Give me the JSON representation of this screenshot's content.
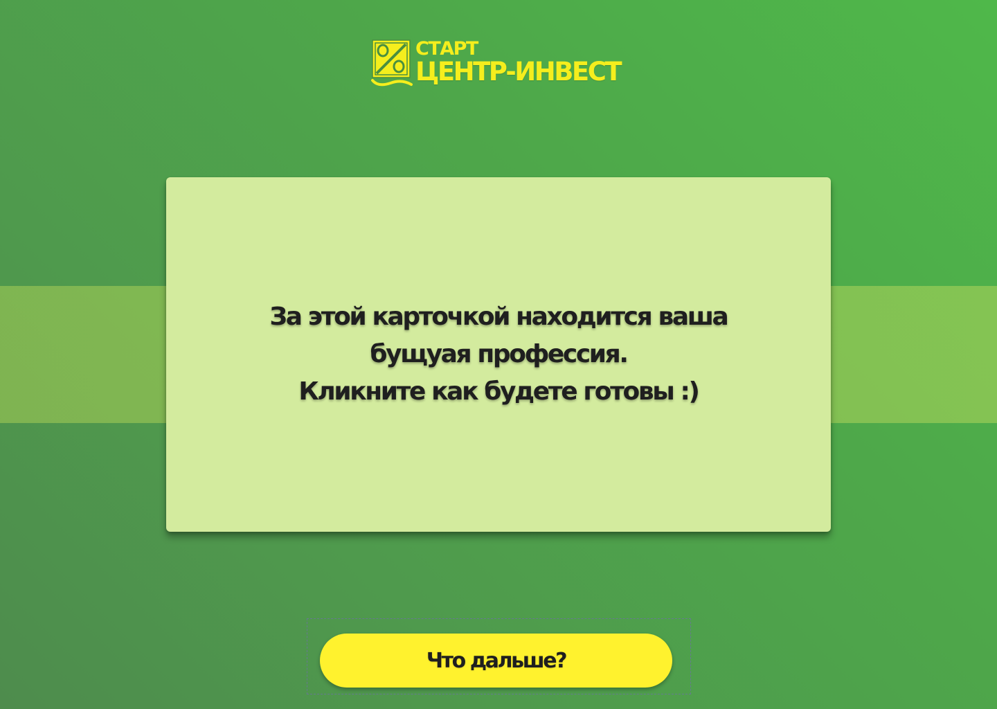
{
  "logo": {
    "line1": "СТАРТ",
    "line2": "ЦЕНТР-ИНВЕСТ",
    "color": "#f5ee1d",
    "icon": "percent-emblem-icon"
  },
  "card": {
    "lines": [
      "За этой карточкой находится ваша",
      "бущуая профессия.",
      "Кликните как будете готовы :)"
    ],
    "background": "#d3eb9e"
  },
  "next_button": {
    "label": "Что дальше?",
    "background": "#fff22e"
  },
  "colors": {
    "page_green": "#4ea84a",
    "text_dark": "#1f1f1f"
  }
}
